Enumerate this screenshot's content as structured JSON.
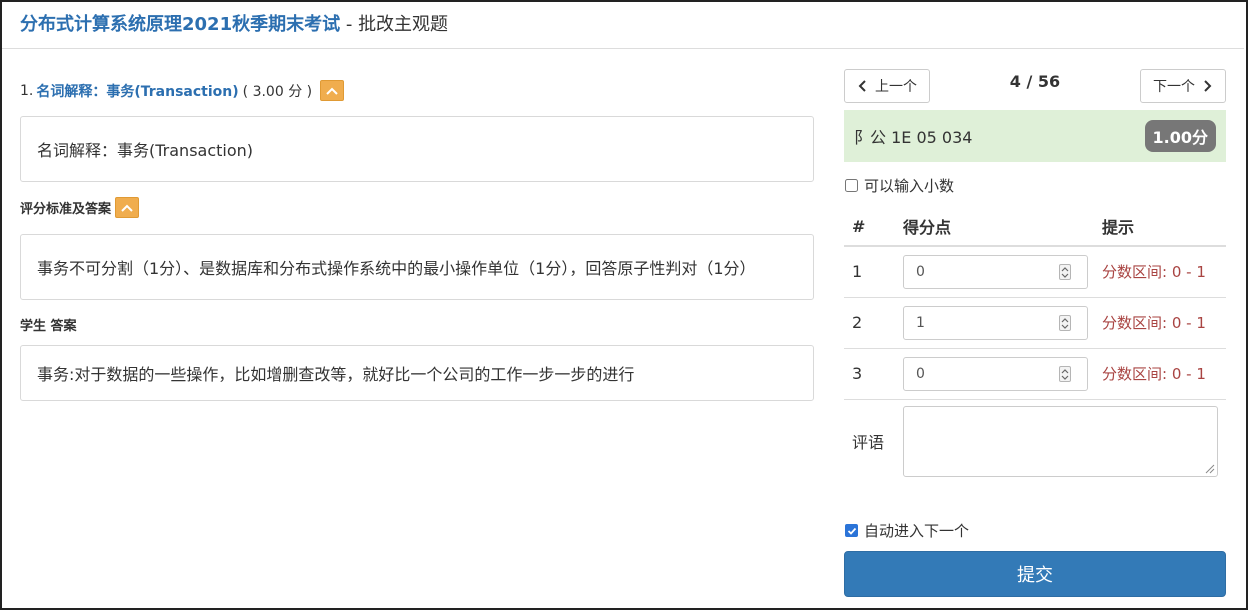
{
  "header": {
    "exam_title": "分布式计算系统原理2021秋季期末考试",
    "separator": " - ",
    "subtitle": "批改主观题"
  },
  "question": {
    "number": "1.",
    "name": "名词解释：事务(Transaction)",
    "score": "( 3.00 分 )",
    "content": "名词解释：事务(Transaction)"
  },
  "rubric": {
    "label": "评分标准及答案",
    "content": "事务不可分割（1分）、是数据库和分布式操作系统中的最小操作单位（1分），回答原子性判对（1分）"
  },
  "student_answer": {
    "label": "学生 答案",
    "content": "事务:对于数据的一些操作，比如增删查改等，就好比一个公司的工作一步一步的进行"
  },
  "navigation": {
    "prev_label": "上一个",
    "next_label": "下一个",
    "counter": "4 / 56"
  },
  "student": {
    "id": "阝公 1E     05   034",
    "score": "1.00分"
  },
  "options": {
    "decimal_label": "可以输入小数",
    "auto_next_label": "自动进入下一个"
  },
  "grading_table": {
    "headers": {
      "num": "#",
      "point": "得分点",
      "hint": "提示"
    },
    "rows": [
      {
        "num": "1",
        "value": "0",
        "hint": "分数区间: 0 - 1"
      },
      {
        "num": "2",
        "value": "1",
        "hint": "分数区间: 0 - 1"
      },
      {
        "num": "3",
        "value": "0",
        "hint": "分数区间: 0 - 1"
      }
    ],
    "comment_label": "评语"
  },
  "submit_label": "提交",
  "colors": {
    "accent": "#2c6fb0",
    "toggle": "#f0ad4e",
    "student_bar": "#dff0d8",
    "hint": "#a94442",
    "submit": "#337ab7"
  },
  "icons": [
    "chevron-up-icon",
    "chevron-left-icon",
    "chevron-right-icon",
    "spinner-icon",
    "resize-grip-icon",
    "checkmark-icon"
  ]
}
